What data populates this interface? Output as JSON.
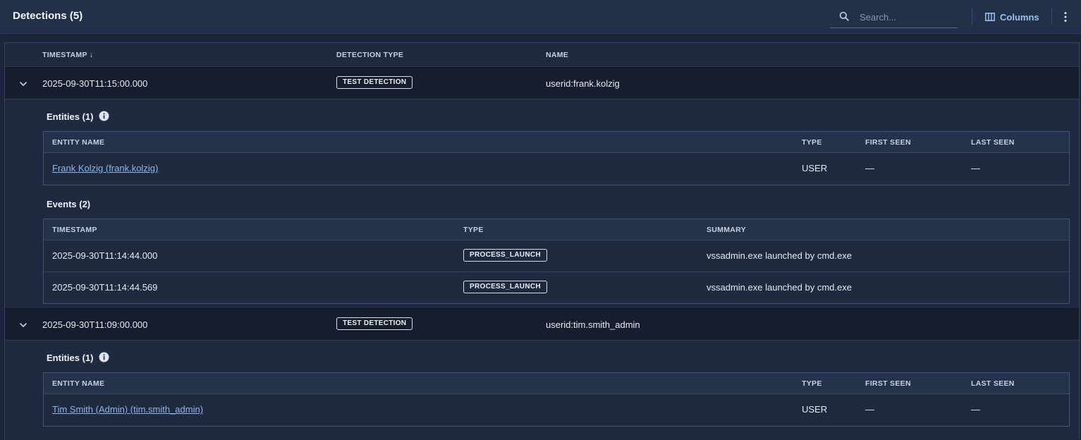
{
  "header": {
    "title": "Detections (5)",
    "search_placeholder": "Search...",
    "columns_label": "Columns"
  },
  "grid": {
    "columns": [
      "TIMESTAMP ↓",
      "DETECTION TYPE",
      "NAME"
    ],
    "rows": [
      {
        "timestamp": "2025-09-30T11:15:00.000",
        "detection_type": "TEST DETECTION",
        "name": "userid:frank.kolzig",
        "entities_title": "Entities (1)",
        "entities_columns": [
          "ENTITY NAME",
          "TYPE",
          "FIRST SEEN",
          "LAST SEEN"
        ],
        "entities": [
          {
            "name": "Frank Kolzig (frank.kolzig)",
            "type": "USER",
            "first_seen": "—",
            "last_seen": "—"
          }
        ],
        "events_title": "Events (2)",
        "events_columns": [
          "TIMESTAMP",
          "TYPE",
          "SUMMARY"
        ],
        "events": [
          {
            "timestamp": "2025-09-30T11:14:44.000",
            "type": "PROCESS_LAUNCH",
            "summary": "vssadmin.exe launched by cmd.exe"
          },
          {
            "timestamp": "2025-09-30T11:14:44.569",
            "type": "PROCESS_LAUNCH",
            "summary": "vssadmin.exe launched by cmd.exe"
          }
        ]
      },
      {
        "timestamp": "2025-09-30T11:09:00.000",
        "detection_type": "TEST DETECTION",
        "name": "userid:tim.smith_admin",
        "entities_title": "Entities (1)",
        "entities_columns": [
          "ENTITY NAME",
          "TYPE",
          "FIRST SEEN",
          "LAST SEEN"
        ],
        "entities": [
          {
            "name": "Tim Smith (Admin) (tim.smith_admin)",
            "type": "USER",
            "first_seen": "—",
            "last_seen": "—"
          }
        ]
      }
    ]
  },
  "colors": {
    "background": "#1c2539",
    "header": "#223049",
    "detection_row": "#161d2d",
    "link": "#8fb5ea",
    "accent": "#9fc0ee"
  },
  "icons": {
    "search": "search-icon",
    "columns": "columns-icon",
    "more": "more-vertical-icon",
    "expand": "chevron-down-icon",
    "info": "info-icon"
  }
}
